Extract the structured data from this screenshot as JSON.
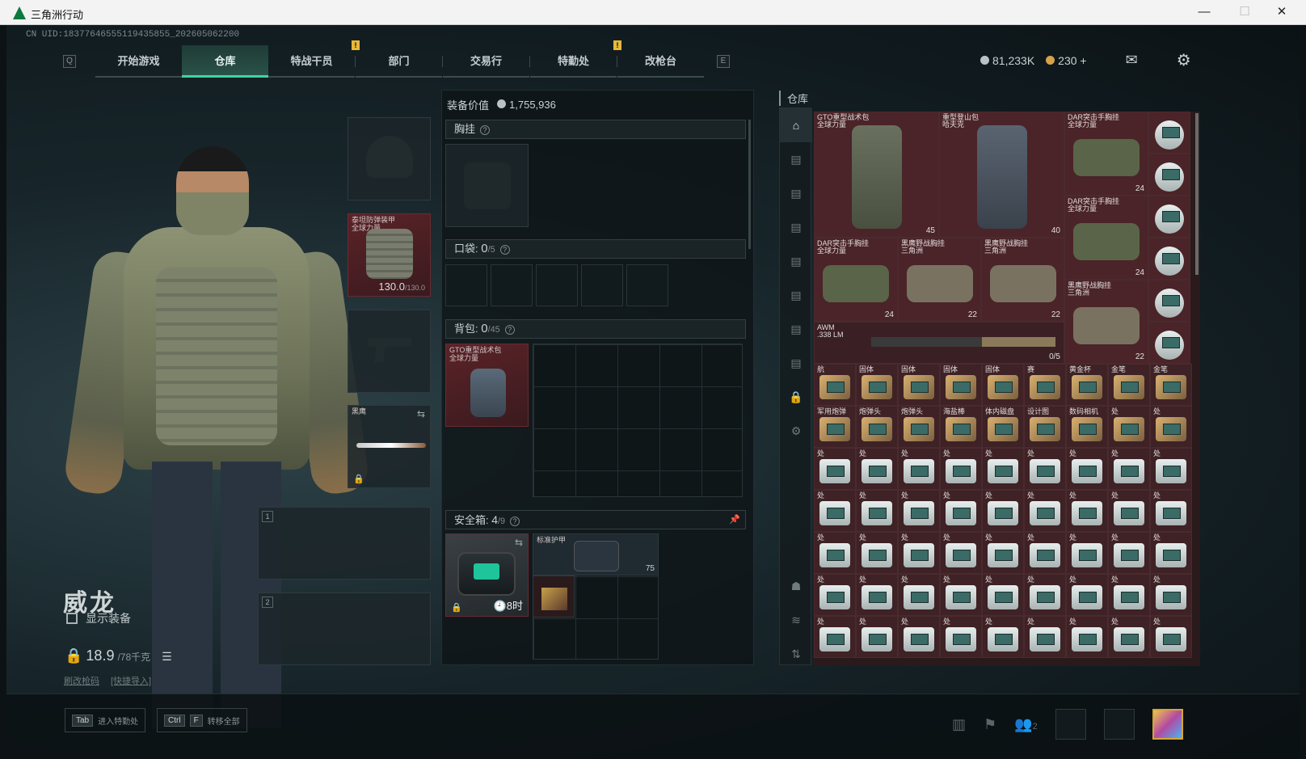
{
  "window": {
    "title": "三角洲行动",
    "min": "—",
    "max": "☐",
    "close": "✕"
  },
  "uid": "CN UID:18377646555119435855_202605062200",
  "nav": {
    "left_key": "Q",
    "right_key": "E",
    "tabs": [
      {
        "label": "开始游戏",
        "active": false,
        "badge": ""
      },
      {
        "label": "仓库",
        "active": true,
        "badge": ""
      },
      {
        "label": "特战干员",
        "active": false,
        "badge": "!"
      },
      {
        "label": "部门",
        "active": false,
        "badge": ""
      },
      {
        "label": "交易行",
        "active": false,
        "badge": ""
      },
      {
        "label": "特勤处",
        "active": false,
        "badge": "!"
      },
      {
        "label": "改枪台",
        "active": false,
        "badge": ""
      }
    ]
  },
  "currency": {
    "havoc_coins": "81,233K",
    "delta_coins": "230",
    "plus": "+"
  },
  "operator": {
    "name": "威龙",
    "show_equipment": "显示装备",
    "weight": "18.9",
    "weight_max": "/78千克",
    "link1": "刷改枪码",
    "link2": "[快捷导入]"
  },
  "loadout": {
    "armor_label": "泰坦防弹装甲\n全球力量",
    "armor_value": "130.0",
    "armor_max": "/130.0",
    "melee_label": "黑鹰",
    "slot1": "1",
    "slot2": "2"
  },
  "equipment": {
    "title": "装备价值",
    "value": "1,755,936",
    "chest_rig": "胸挂",
    "pockets": "口袋: ",
    "pockets_count": "0",
    "pockets_max": "/5",
    "backpack": "背包: ",
    "backpack_count": "0",
    "backpack_max": "/45",
    "backpack_item": "GTO重型战术包\n全球力量",
    "safe_box": "安全箱: ",
    "safe_count": "4",
    "safe_max": "/9",
    "safe_timer": "8时",
    "safe_armor_label": "标准护甲",
    "safe_armor_val": "75"
  },
  "stash": {
    "title": "仓库",
    "big_items": [
      {
        "label": "GTO重型战术包\n全球力量",
        "count": "45"
      },
      {
        "label": "重型登山包\n哈夫克",
        "count": "40"
      }
    ],
    "bags": [
      {
        "label": "DAR突击手胸挂\n全球力量",
        "count": "24"
      },
      {
        "label": "DAR突击手胸挂\n全球力量",
        "count": "24"
      },
      {
        "label": "DAR突击手胸挂\n全球力量",
        "count": "24"
      },
      {
        "label": "黑鹰野战胸挂\n三角洲",
        "count": "22"
      },
      {
        "label": "黑鹰野战胸挂\n三角洲",
        "count": "22"
      },
      {
        "label": "黑鹰野战胸挂\n三角洲",
        "count": "22"
      }
    ],
    "rifle": {
      "label": "AWM\n.338 LM",
      "count": "0/5"
    },
    "row1": [
      "航",
      "固体",
      "固体",
      "固体",
      "固体",
      "赛",
      "黄金杯",
      "金笔",
      "金笔"
    ],
    "row2": [
      "军用炮弹",
      "炮弹头",
      "炮弹头",
      "海盐棒",
      "体内磁盘",
      "设计图",
      "数码相机",
      "处",
      "处"
    ],
    "case_label": "处"
  },
  "bottom": {
    "tab_key": "Tab",
    "tab_label": "进入特勤处",
    "ctrl_key": "Ctrl",
    "f_key": "F",
    "ctrl_label": "转移全部",
    "squad_count": "2"
  },
  "colors": {
    "accent": "#3dd6a2",
    "stash_bg": "#2a1a1c",
    "item_red": "#5a2328"
  }
}
